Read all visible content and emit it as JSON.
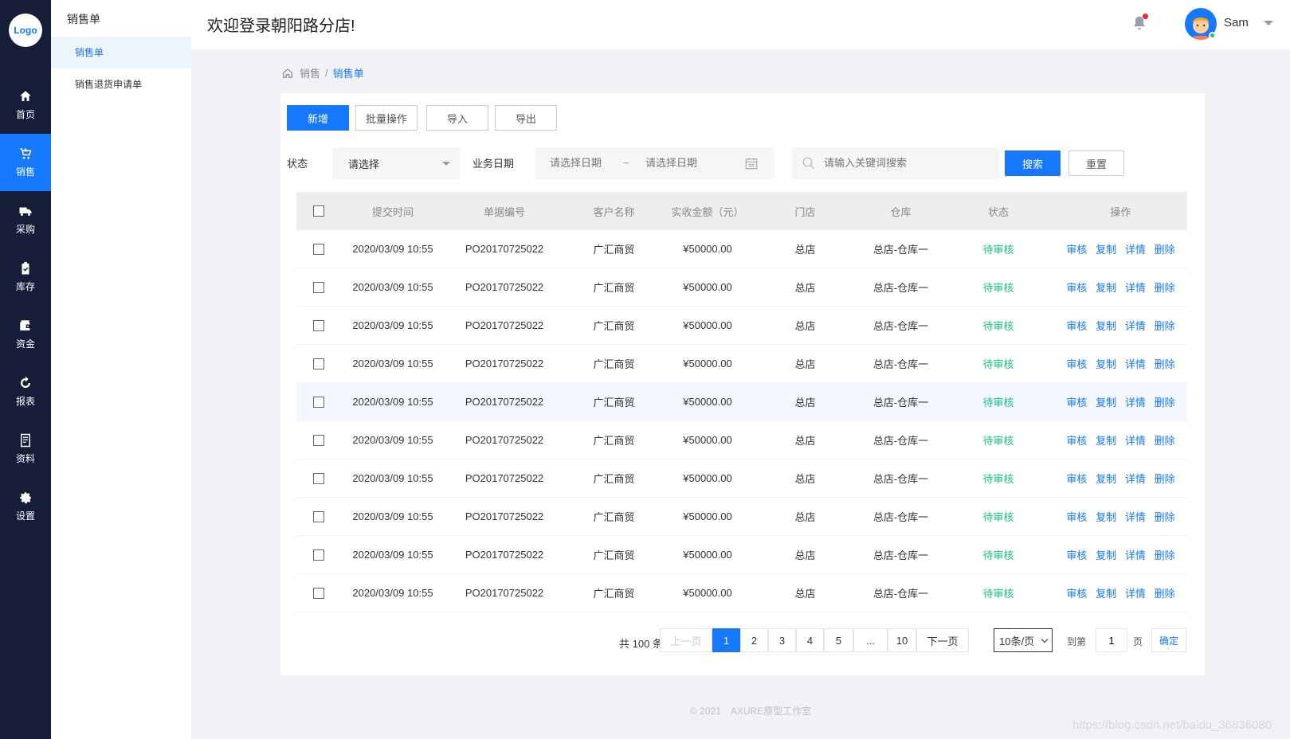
{
  "nav": {
    "logo": "Logo",
    "items": [
      {
        "label": "首页",
        "icon": "home-icon"
      },
      {
        "label": "销售",
        "icon": "cart-icon",
        "active": true
      },
      {
        "label": "采购",
        "icon": "truck-icon"
      },
      {
        "label": "库存",
        "icon": "clipboard-check-icon"
      },
      {
        "label": "资金",
        "icon": "wallet-icon"
      },
      {
        "label": "报表",
        "icon": "refresh-icon"
      },
      {
        "label": "资料",
        "icon": "document-icon"
      },
      {
        "label": "设置",
        "icon": "gear-icon"
      }
    ]
  },
  "subnav": {
    "title": "销售单",
    "items": [
      {
        "label": "销售单",
        "active": true
      },
      {
        "label": "销售退货申请单"
      }
    ]
  },
  "header": {
    "welcome": "欢迎登录朝阳路分店!",
    "username": "Sam"
  },
  "breadcrumb": {
    "root": "销售",
    "separator": "/",
    "current": "销售单"
  },
  "toolbar": {
    "add": "新增",
    "batch": "批量操作",
    "import": "导入",
    "export": "导出"
  },
  "filters": {
    "status_label": "状态",
    "status_value": "请选择",
    "date_label": "业务日期",
    "date_start_placeholder": "请选择日期",
    "date_tilde": "~",
    "date_end_placeholder": "请选择日期",
    "search_placeholder": "请输入关键词搜索",
    "search_btn": "搜索",
    "reset_btn": "重置"
  },
  "table": {
    "headers": [
      "提交时间",
      "单据编号",
      "客户名称",
      "实收金额（元）",
      "门店",
      "仓库",
      "状态",
      "操作"
    ],
    "actions": [
      "审核",
      "复制",
      "详情",
      "删除"
    ],
    "rows": [
      {
        "time": "2020/03/09 10:55",
        "no": "PO20170725022",
        "customer": "广汇商贸",
        "amount": "¥50000.00",
        "store": "总店",
        "warehouse": "总店-仓库一",
        "status": "待审核"
      },
      {
        "time": "2020/03/09 10:55",
        "no": "PO20170725022",
        "customer": "广汇商贸",
        "amount": "¥50000.00",
        "store": "总店",
        "warehouse": "总店-仓库一",
        "status": "待审核"
      },
      {
        "time": "2020/03/09 10:55",
        "no": "PO20170725022",
        "customer": "广汇商贸",
        "amount": "¥50000.00",
        "store": "总店",
        "warehouse": "总店-仓库一",
        "status": "待审核"
      },
      {
        "time": "2020/03/09 10:55",
        "no": "PO20170725022",
        "customer": "广汇商贸",
        "amount": "¥50000.00",
        "store": "总店",
        "warehouse": "总店-仓库一",
        "status": "待审核"
      },
      {
        "time": "2020/03/09 10:55",
        "no": "PO20170725022",
        "customer": "广汇商贸",
        "amount": "¥50000.00",
        "store": "总店",
        "warehouse": "总店-仓库一",
        "status": "待审核",
        "highlight": true
      },
      {
        "time": "2020/03/09 10:55",
        "no": "PO20170725022",
        "customer": "广汇商贸",
        "amount": "¥50000.00",
        "store": "总店",
        "warehouse": "总店-仓库一",
        "status": "待审核"
      },
      {
        "time": "2020/03/09 10:55",
        "no": "PO20170725022",
        "customer": "广汇商贸",
        "amount": "¥50000.00",
        "store": "总店",
        "warehouse": "总店-仓库一",
        "status": "待审核"
      },
      {
        "time": "2020/03/09 10:55",
        "no": "PO20170725022",
        "customer": "广汇商贸",
        "amount": "¥50000.00",
        "store": "总店",
        "warehouse": "总店-仓库一",
        "status": "待审核"
      },
      {
        "time": "2020/03/09 10:55",
        "no": "PO20170725022",
        "customer": "广汇商贸",
        "amount": "¥50000.00",
        "store": "总店",
        "warehouse": "总店-仓库一",
        "status": "待审核"
      },
      {
        "time": "2020/03/09 10:55",
        "no": "PO20170725022",
        "customer": "广汇商贸",
        "amount": "¥50000.00",
        "store": "总店",
        "warehouse": "总店-仓库一",
        "status": "待审核"
      }
    ]
  },
  "pagination": {
    "total": "共 100 条",
    "prev": "上一页",
    "pages": [
      "1",
      "2",
      "3",
      "4",
      "5",
      "...",
      "10"
    ],
    "current": "1",
    "next": "下一页",
    "page_size": "10条/页",
    "goto_label": "到第",
    "goto_value": "1",
    "page_unit": "页",
    "confirm": "确定"
  },
  "footer": "© 2021　AXURE原型工作室",
  "watermark": "https://blog.csdn.net/baidu_36836080",
  "colors": {
    "nav_bg": "#161d38",
    "primary": "#1677ff",
    "status_pending": "#1bbf8a"
  }
}
